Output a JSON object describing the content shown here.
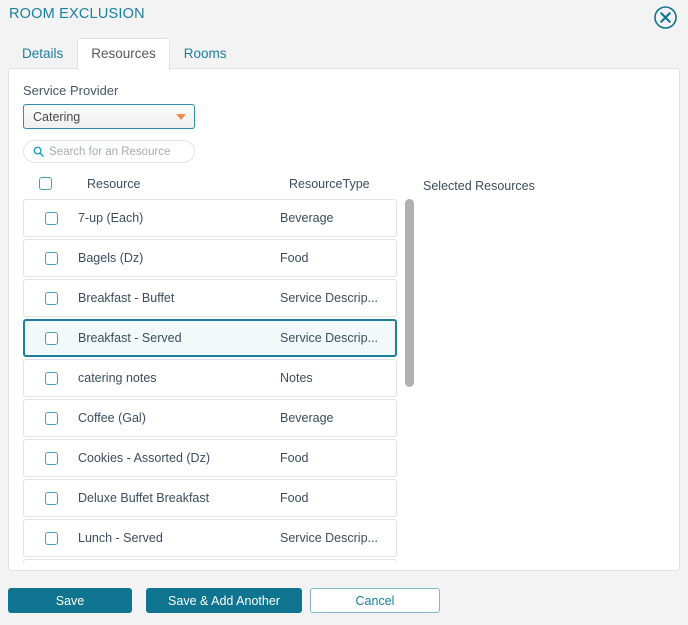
{
  "header": {
    "title": "ROOM EXCLUSION",
    "close_icon": "close-circle-icon"
  },
  "tabs": [
    {
      "label": "Details",
      "active": false
    },
    {
      "label": "Resources",
      "active": true
    },
    {
      "label": "Rooms",
      "active": false
    }
  ],
  "form": {
    "service_provider_label": "Service Provider",
    "service_provider_value": "Catering",
    "caret_icon": "chevron-down-icon",
    "search_icon": "search-icon",
    "search_placeholder": "Search for an Resource",
    "search_value": ""
  },
  "table": {
    "columns": [
      "Resource",
      "ResourceType"
    ],
    "rows": [
      {
        "resource": "7-up (Each)",
        "type": "Beverage",
        "checked": false,
        "selected": false
      },
      {
        "resource": "Bagels (Dz)",
        "type": "Food",
        "checked": false,
        "selected": false
      },
      {
        "resource": "Breakfast - Buffet",
        "type": "Service Descrip...",
        "checked": false,
        "selected": false
      },
      {
        "resource": "Breakfast - Served",
        "type": "Service Descrip...",
        "checked": false,
        "selected": true
      },
      {
        "resource": "catering notes",
        "type": "Notes",
        "checked": false,
        "selected": false
      },
      {
        "resource": "Coffee (Gal)",
        "type": "Beverage",
        "checked": false,
        "selected": false
      },
      {
        "resource": "Cookies - Assorted (Dz)",
        "type": "Food",
        "checked": false,
        "selected": false
      },
      {
        "resource": "Deluxe Buffet Breakfast",
        "type": "Food",
        "checked": false,
        "selected": false
      },
      {
        "resource": "Lunch - Served",
        "type": "Service Descrip...",
        "checked": false,
        "selected": false
      },
      {
        "resource": "",
        "type": "",
        "checked": false,
        "selected": false
      }
    ]
  },
  "selected_panel": {
    "title": "Selected Resources",
    "items": []
  },
  "footer": {
    "save_label": "Save",
    "save_add_label": "Save & Add Another",
    "cancel_label": "Cancel"
  },
  "colors": {
    "accent_teal": "#0e7490",
    "link_teal": "#1b7f9e",
    "caret_orange": "#ef8b4f",
    "text_slate": "#3c4d5e",
    "page_bg": "#f3f3f3",
    "selected_row_bg": "#f1f9fb"
  }
}
